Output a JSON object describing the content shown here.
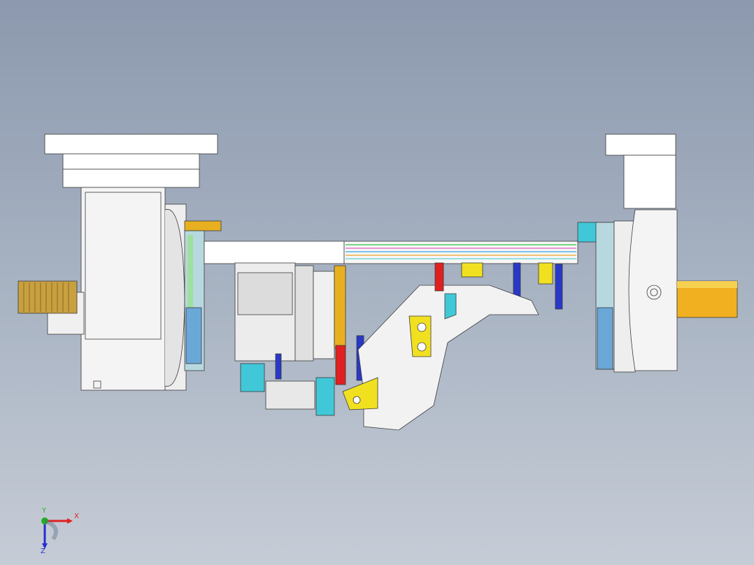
{
  "viewport": {
    "background_top": "#8c99ae",
    "background_bottom": "#c6ccd6"
  },
  "triad": {
    "x_label": "X",
    "y_label": "Y",
    "z_label": "Z",
    "x_color": "#e02020",
    "y_color": "#20b020",
    "z_color": "#2030d0"
  },
  "colors": {
    "body": "#ffffff",
    "outline": "#3a3a3a",
    "gold": "#e8b020",
    "yellow": "#f0e020",
    "cyan": "#40c8d8",
    "blue": "#2838c8",
    "red": "#e02020",
    "brass": "#c8a040"
  }
}
